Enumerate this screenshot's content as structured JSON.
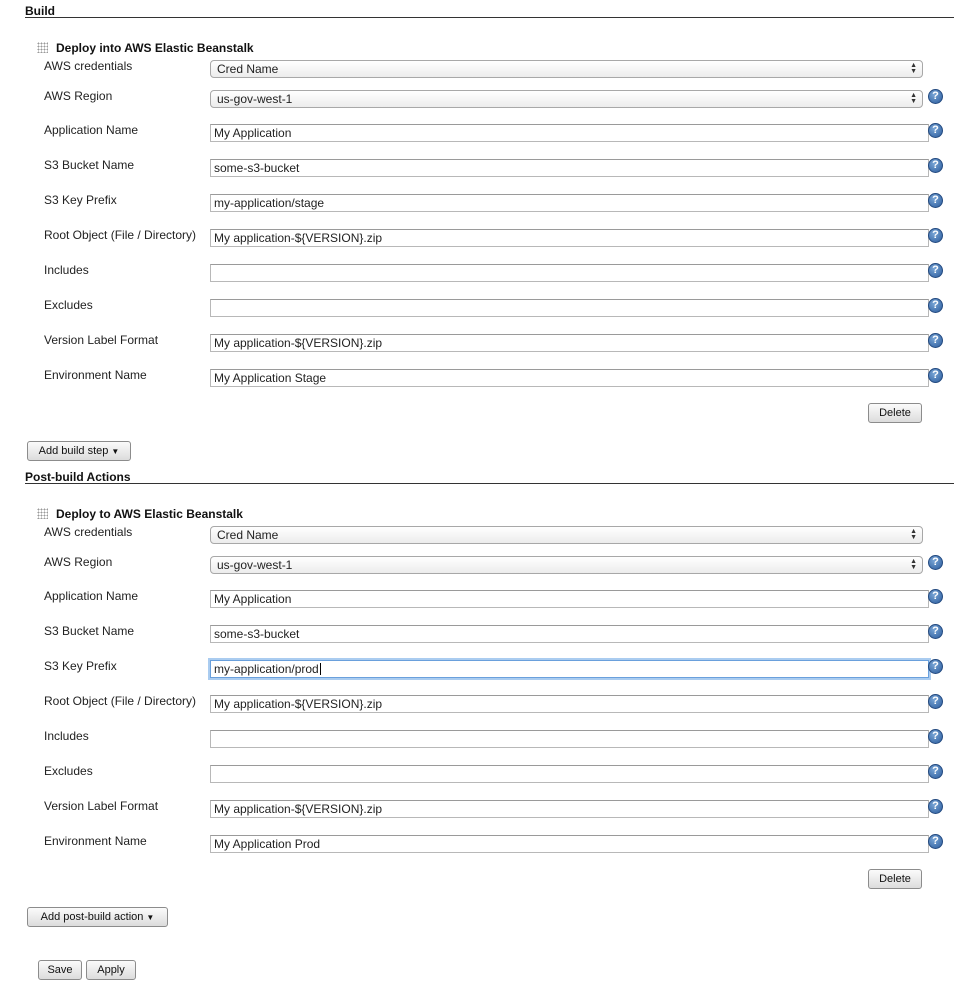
{
  "build": {
    "section_title": "Build",
    "step_title": "Deploy into AWS Elastic Beanstalk",
    "labels": {
      "credentials": "AWS credentials",
      "region": "AWS Region",
      "app_name": "Application Name",
      "bucket": "S3 Bucket Name",
      "key_prefix": "S3 Key Prefix",
      "root_object": "Root Object (File / Directory)",
      "includes": "Includes",
      "excludes": "Excludes",
      "version_label": "Version Label Format",
      "env_name": "Environment Name"
    },
    "values": {
      "credentials": "Cred Name",
      "region": "us-gov-west-1",
      "app_name": "My Application",
      "bucket": "some-s3-bucket",
      "key_prefix": "my-application/stage",
      "root_object": "My application-${VERSION}.zip",
      "includes": "",
      "excludes": "",
      "version_label": "My application-${VERSION}.zip",
      "env_name": "My Application Stage"
    },
    "delete_label": "Delete",
    "add_label": "Add build step"
  },
  "post": {
    "section_title": "Post-build Actions",
    "step_title": "Deploy to AWS Elastic Beanstalk",
    "labels": {
      "credentials": "AWS credentials",
      "region": "AWS Region",
      "app_name": "Application Name",
      "bucket": "S3 Bucket Name",
      "key_prefix": "S3 Key Prefix",
      "root_object": "Root Object (File / Directory)",
      "includes": "Includes",
      "excludes": "Excludes",
      "version_label": "Version Label Format",
      "env_name": "Environment Name"
    },
    "values": {
      "credentials": "Cred Name",
      "region": "us-gov-west-1",
      "app_name": "My Application",
      "bucket": "some-s3-bucket",
      "key_prefix": "my-application/prod",
      "root_object": "My application-${VERSION}.zip",
      "includes": "",
      "excludes": "",
      "version_label": "My application-${VERSION}.zip",
      "env_name": "My Application Prod"
    },
    "delete_label": "Delete",
    "add_label": "Add post-build action"
  },
  "footer": {
    "save_label": "Save",
    "apply_label": "Apply"
  },
  "icons": {
    "help": "help-icon",
    "dropdown": "chevron-down-icon",
    "drag": "drag-handle-icon"
  },
  "help_glyph": "?"
}
